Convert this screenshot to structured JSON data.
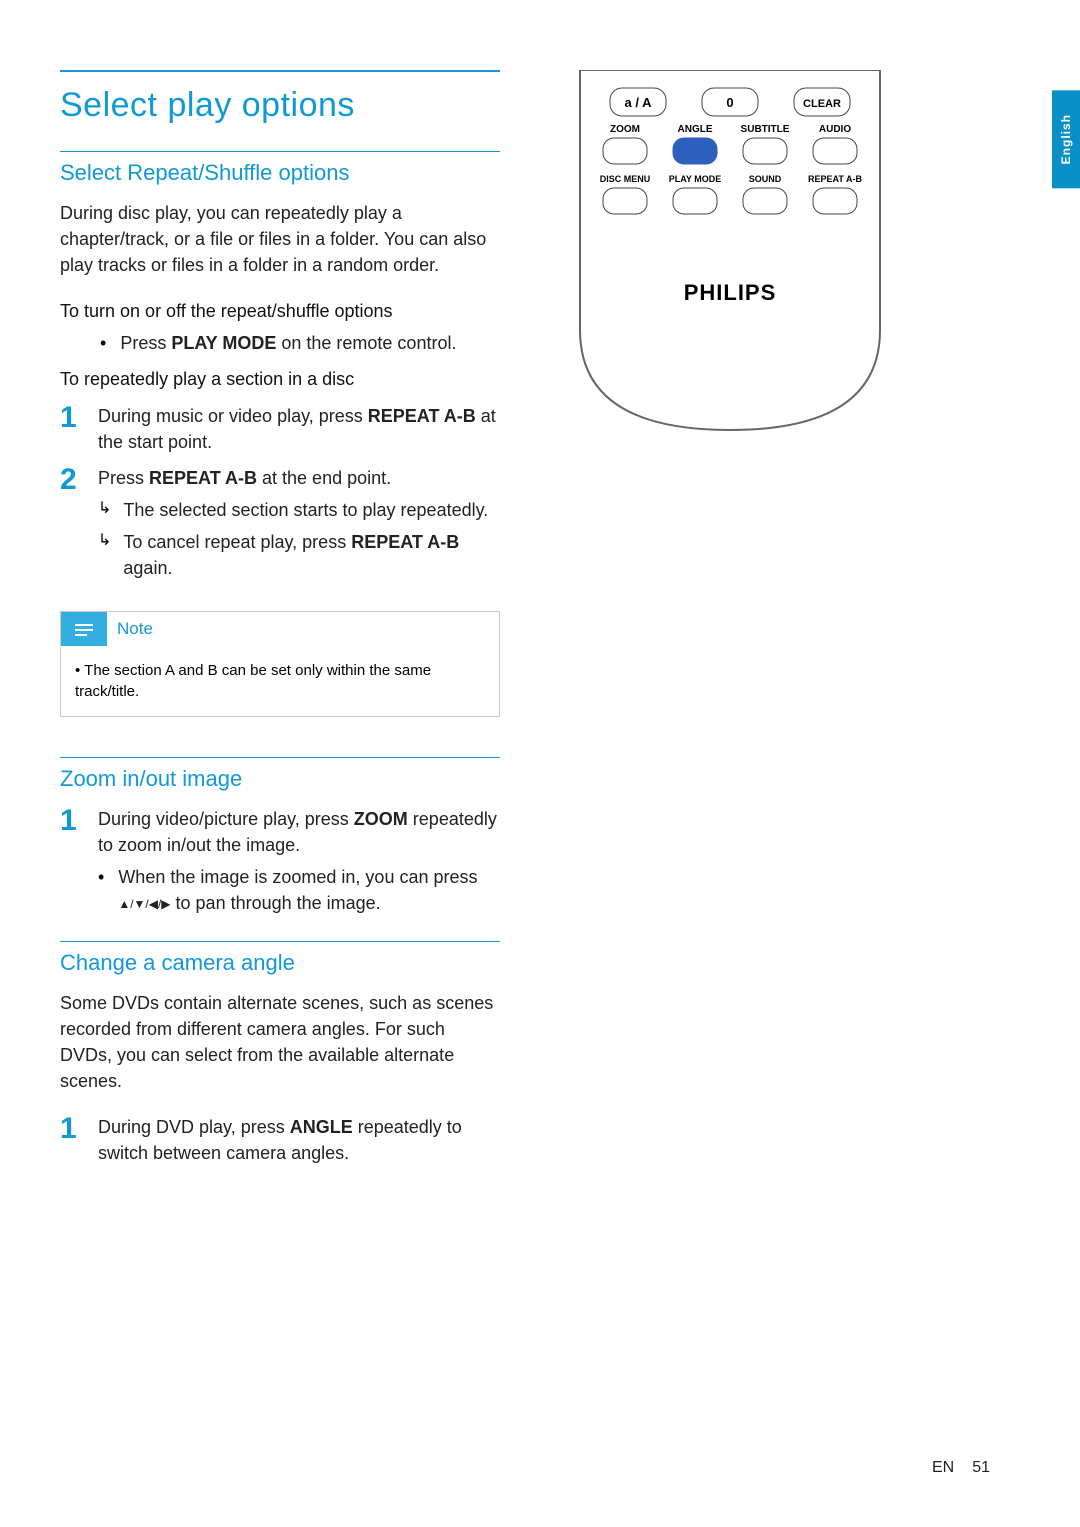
{
  "title": "Select play options",
  "h2_repeat": "Select Repeat/Shuffle options",
  "p_repeat_intro": "During disc play, you can repeatedly play a chapter/track, or a file or files in a folder. You can also play tracks or files in a folder in a random order.",
  "subhead_toggle": "To turn on or off the repeat/shuffle options",
  "bullet_press1_pre": "Press ",
  "bullet_press1_bold": "PLAY MODE",
  "bullet_press1_post": " on the remote control.",
  "subhead_section": "To repeatedly play a section in a disc",
  "step1_pre": "During music or video play, press ",
  "step1_bold": "REPEAT A-B",
  "step1_post": " at the start point.",
  "step2_pre": "Press ",
  "step2_bold": "REPEAT A-B",
  "step2_post": " at the end point.",
  "step2_sub1": "The selected section starts to play repeatedly.",
  "step2_sub2_pre": "To cancel repeat play, press ",
  "step2_sub2_bold": "REPEAT A-B",
  "step2_sub2_post": " again.",
  "note_label": "Note",
  "note_text": "The section A and B can be set only within the same track/title.",
  "h2_zoom": "Zoom in/out image",
  "zoom_step1_pre": "During video/picture play, press ",
  "zoom_step1_bold": "ZOOM",
  "zoom_step1_post": " repeatedly to zoom in/out the image.",
  "zoom_bullet_pre": "When the image is zoomed in, you can press ",
  "zoom_bullet_post": " to pan through the image.",
  "h2_angle": "Change a camera angle",
  "angle_intro": "Some DVDs contain alternate scenes, such as scenes recorded from different camera angles. For such DVDs, you can select from the available alternate scenes.",
  "angle_step1_pre": "During DVD play, press ",
  "angle_step1_bold": "ANGLE",
  "angle_step1_post": " repeatedly to switch between camera angles.",
  "remote": {
    "row1": {
      "b1": "a / A",
      "b2": "0",
      "b3": "CLEAR"
    },
    "row2": {
      "l1": "ZOOM",
      "l2": "ANGLE",
      "l3": "SUBTITLE",
      "l4": "AUDIO"
    },
    "row3": {
      "l1": "DISC MENU",
      "l2": "PLAY MODE",
      "l3": "SOUND",
      "l4": "REPEAT A-B"
    },
    "brand": "PHILIPS"
  },
  "lang_tab": "English",
  "footer_lang": "EN",
  "footer_page": "51",
  "nums": {
    "one": "1",
    "two": "2"
  }
}
